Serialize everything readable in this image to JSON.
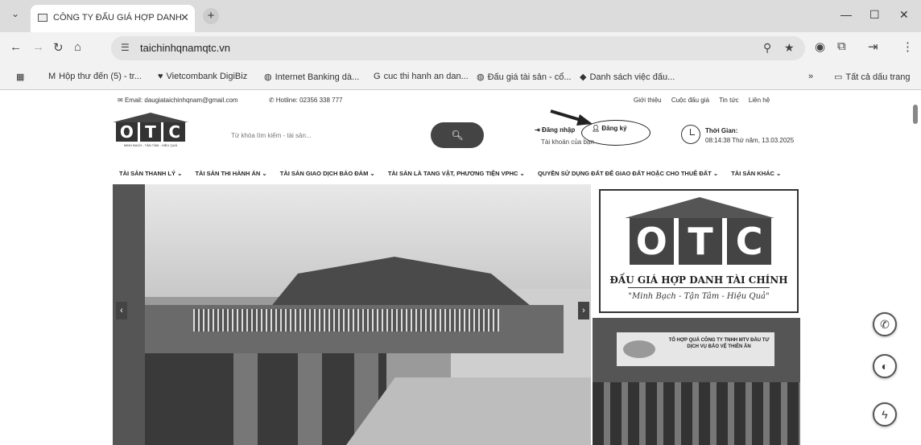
{
  "browser": {
    "tab_title": "CÔNG TY ĐẤU GIÁ HỢP DANH",
    "url": "taichinhqnamqtc.vn",
    "bookmarks": [
      "Hộp thư đến (5) - tr...",
      "Vietcombank DigiBiz",
      "Internet Banking dà...",
      "cuc thi hanh an dan...",
      "Đấu giá tài sản - cổ...",
      "Danh sách việc đấu...",
      "Tất cả dấu trang"
    ]
  },
  "site": {
    "email": "Email: daugiataichinhqnam@gmail.com",
    "hotline": "Hotline: 02356 338 777",
    "top_links": [
      "Giới thiệu",
      "Cuộc đấu giá",
      "Tin tức",
      "Liên hệ"
    ],
    "logo_letters": [
      "O",
      "T",
      "C"
    ],
    "logo_tagline": "MINH BẠCH - TẬN TÂM - HIỆU QUẢ",
    "search_placeholder": "Từ khóa tìm kiếm - tài sản...",
    "login": "Đăng nhập",
    "register": "Đăng ký",
    "account": "Tài khoản của bạn",
    "time_label": "Thời Gian:",
    "time_value": "08:14:38 Thứ năm, 13.03.2025",
    "nav": [
      "TÀI SẢN THANH LÝ ⌄",
      "TÀI SẢN THI HÀNH ÁN ⌄",
      "TÀI SẢN GIAO DỊCH BẢO ĐẢM ⌄",
      "TÀI SẢN LÀ TANG VẬT, PHƯƠNG TIỆN VPHC ⌄",
      "QUYỀN SỬ DỤNG ĐẤT ĐỂ GIAO ĐẤT HOẶC CHO THUÊ ĐẤT ⌄",
      "TÀI SẢN KHÁC ⌄"
    ],
    "card_name": "ĐẤU GIÁ HỢP DANH TÀI CHÍNH",
    "card_slogan": "\"Minh Bạch - Tận Tâm - Hiệu Quả\"",
    "photo_sign": "TỔ HỢP QUẢ CÔNG TY TNHH MTV ĐẦU TƯ DỊCH VỤ BẢO VỆ THIÊN ÂN"
  }
}
